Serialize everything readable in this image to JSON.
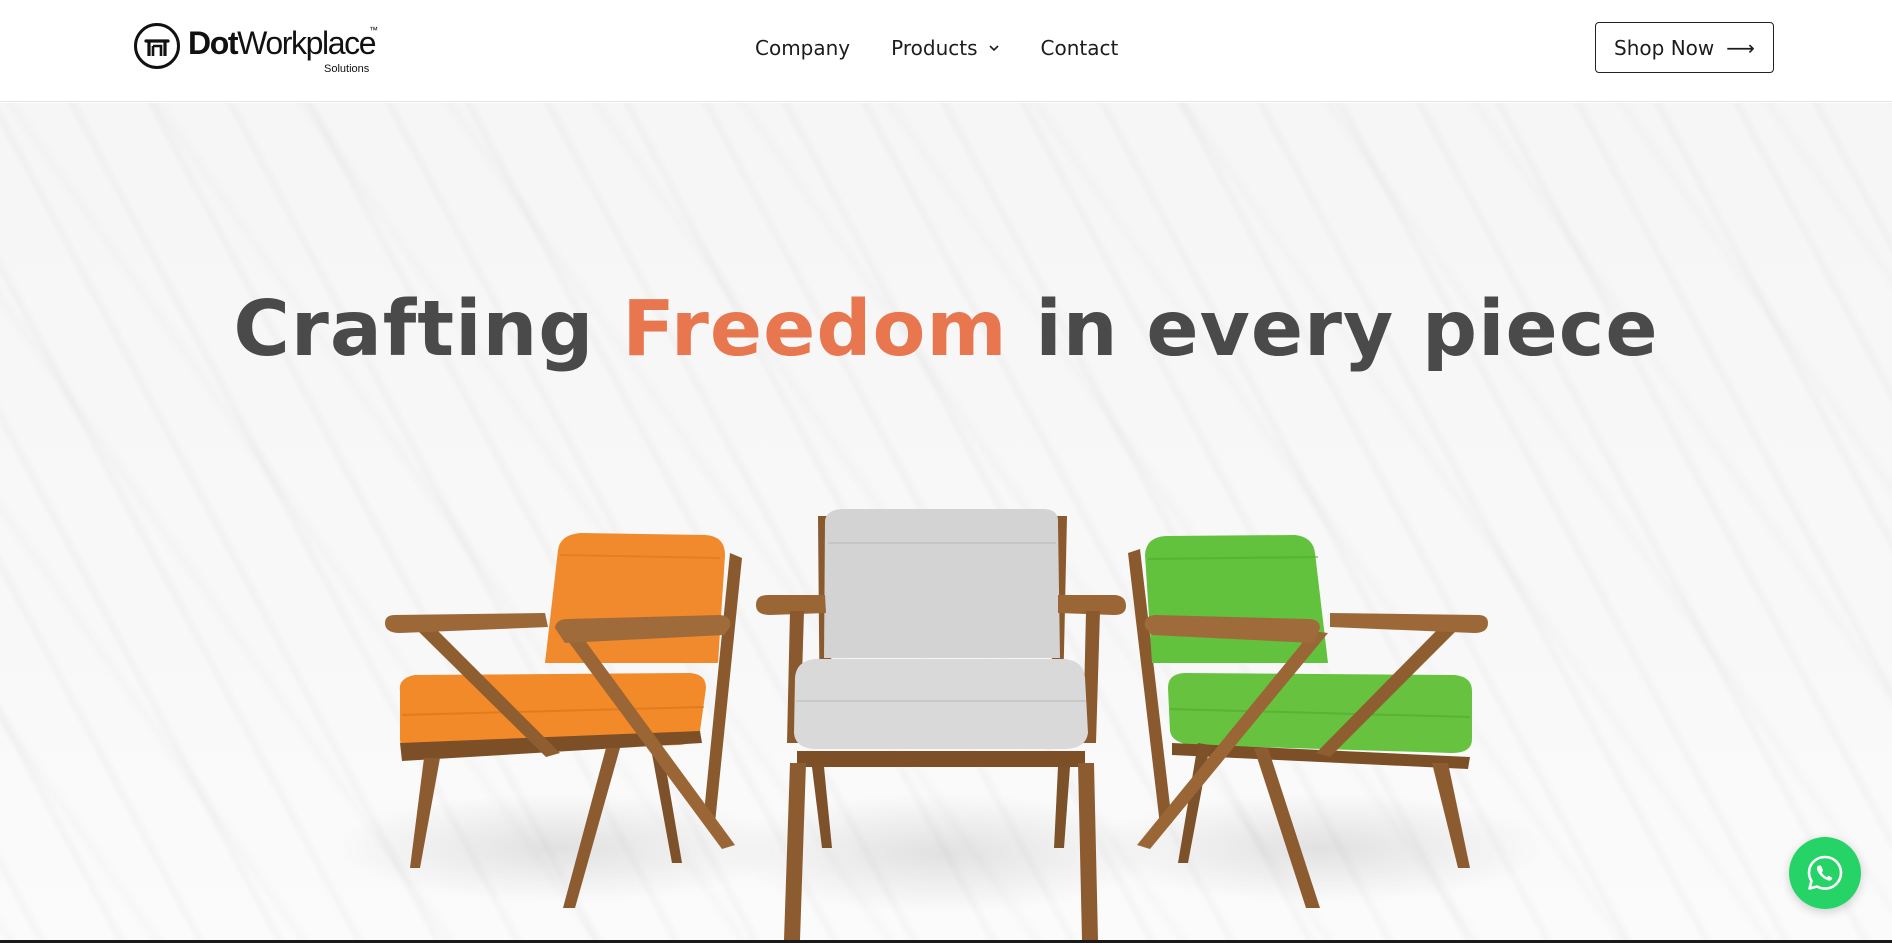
{
  "brand": {
    "name_bold": "Dot",
    "name_regular": "Workplace",
    "trademark": "™",
    "tagline": "Solutions"
  },
  "nav": {
    "items": [
      {
        "label": "Company",
        "has_dropdown": false
      },
      {
        "label": "Products",
        "has_dropdown": true
      },
      {
        "label": "Contact",
        "has_dropdown": false
      }
    ]
  },
  "cta": {
    "label": "Shop Now",
    "arrow": "⟶"
  },
  "hero": {
    "headline_before": "Crafting ",
    "headline_highlight": "Freedom",
    "headline_after": " in every piece",
    "highlight_color": "#e8764f",
    "chairs": [
      {
        "name": "orange-armchair",
        "cushion_color": "#f08a2c"
      },
      {
        "name": "gray-armchair",
        "cushion_color": "#cfcfcf"
      },
      {
        "name": "green-armchair",
        "cushion_color": "#62c13d"
      }
    ]
  },
  "floating": {
    "whatsapp_icon": "whatsapp-icon",
    "whatsapp_color": "#25d366"
  }
}
